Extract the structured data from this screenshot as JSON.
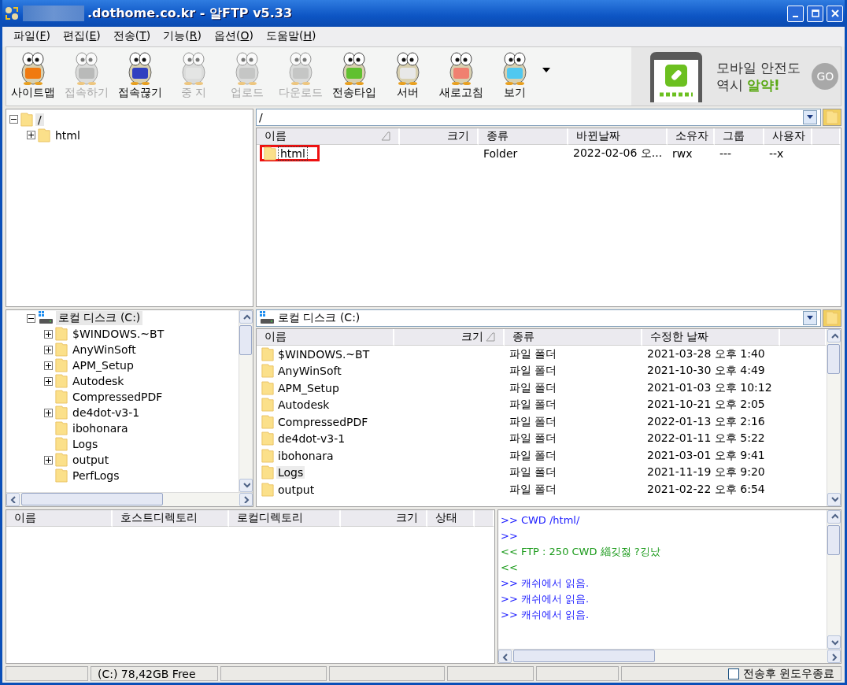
{
  "window": {
    "title": ".dothome.co.kr - 알FTP v5.33"
  },
  "menu": [
    "파일(F)",
    "편집(E)",
    "전송(T)",
    "기능(R)",
    "옵션(O)",
    "도움말(H)"
  ],
  "toolbar": [
    {
      "label": "사이트맵",
      "disabled": false
    },
    {
      "label": "접속하기",
      "disabled": true
    },
    {
      "label": "접속끊기",
      "disabled": false
    },
    {
      "label": "중 지",
      "disabled": true
    },
    {
      "label": "업로드",
      "disabled": true
    },
    {
      "label": "다운로드",
      "disabled": true
    },
    {
      "label": "전송타입",
      "disabled": false
    },
    {
      "label": "서버",
      "disabled": false
    },
    {
      "label": "새로고침",
      "disabled": false
    },
    {
      "label": "보기",
      "disabled": false
    }
  ],
  "ad": {
    "line_1": "모바일 안전도",
    "line_2": "역시",
    "highlight": "알약!",
    "button": "GO"
  },
  "remote": {
    "tree": [
      {
        "name": "/",
        "kind": "folder",
        "expandable": true,
        "expanded": true,
        "selected": true,
        "children": [
          {
            "name": "html",
            "kind": "folder",
            "expandable": true,
            "expanded": false,
            "selected": false
          }
        ]
      }
    ],
    "path": "/",
    "columns": [
      "이름",
      "크기",
      "종류",
      "바뀐날짜",
      "소유자",
      "그룹",
      "사용자"
    ],
    "rows": [
      {
        "name": "html",
        "size": "",
        "type": "Folder",
        "date": "2022-02-06 오...",
        "owner": "rwx",
        "group": "---",
        "user": "--x",
        "highlighted": true
      }
    ]
  },
  "local": {
    "tree": [
      {
        "name": "로컬 디스크 (C:)",
        "kind": "drive",
        "expandable": true,
        "expanded": true,
        "selected": true,
        "children": [
          {
            "name": "$WINDOWS.~BT",
            "kind": "folder",
            "expandable": true,
            "expanded": false,
            "selected": false
          },
          {
            "name": "AnyWinSoft",
            "kind": "folder",
            "expandable": true,
            "expanded": false,
            "selected": false
          },
          {
            "name": "APM_Setup",
            "kind": "folder",
            "expandable": true,
            "expanded": false,
            "selected": false
          },
          {
            "name": "Autodesk",
            "kind": "folder",
            "expandable": true,
            "expanded": false,
            "selected": false
          },
          {
            "name": "CompressedPDF",
            "kind": "folder",
            "expandable": false,
            "selected": false
          },
          {
            "name": "de4dot-v3-1",
            "kind": "folder",
            "expandable": true,
            "expanded": false,
            "selected": false
          },
          {
            "name": "ibohonara",
            "kind": "folder",
            "expandable": false,
            "selected": false
          },
          {
            "name": "Logs",
            "kind": "folder",
            "expandable": false,
            "selected": false
          },
          {
            "name": "output",
            "kind": "folder",
            "expandable": true,
            "expanded": false,
            "selected": false
          },
          {
            "name": "PerfLogs",
            "kind": "folder",
            "expandable": false,
            "selected": false
          }
        ]
      }
    ],
    "path": "로컬 디스크 (C:)",
    "columns": [
      "이름",
      "크기",
      "종류",
      "수정한 날짜"
    ],
    "rows": [
      {
        "name": "$WINDOWS.~BT",
        "size": "",
        "type": "파일 폴더",
        "date": "2021-03-28 오후 1:40",
        "selected": false
      },
      {
        "name": "AnyWinSoft",
        "size": "",
        "type": "파일 폴더",
        "date": "2021-10-30 오후 4:49",
        "selected": false
      },
      {
        "name": "APM_Setup",
        "size": "",
        "type": "파일 폴더",
        "date": "2021-01-03 오후 10:12",
        "selected": false
      },
      {
        "name": "Autodesk",
        "size": "",
        "type": "파일 폴더",
        "date": "2021-10-21 오후 2:05",
        "selected": false
      },
      {
        "name": "CompressedPDF",
        "size": "",
        "type": "파일 폴더",
        "date": "2022-01-13 오후 2:16",
        "selected": false
      },
      {
        "name": "de4dot-v3-1",
        "size": "",
        "type": "파일 폴더",
        "date": "2022-01-11 오후 5:22",
        "selected": false
      },
      {
        "name": "ibohonara",
        "size": "",
        "type": "파일 폴더",
        "date": "2021-03-01 오후 9:41",
        "selected": false
      },
      {
        "name": "Logs",
        "size": "",
        "type": "파일 폴더",
        "date": "2021-11-19 오후 9:20",
        "selected": true
      },
      {
        "name": "output",
        "size": "",
        "type": "파일 폴더",
        "date": "2021-02-22 오후 6:54",
        "selected": false
      }
    ]
  },
  "queue": {
    "columns": [
      "이름",
      "호스트디렉토리",
      "로컬디렉토리",
      "크기",
      "상태"
    ]
  },
  "log": [
    {
      "text": ">> CWD /html/",
      "kind": "sent"
    },
    {
      "text": ">>",
      "kind": "sent"
    },
    {
      "text": "<< FTP : 250 CWD 緇깆젏 ?깅났",
      "kind": "received"
    },
    {
      "text": "<<",
      "kind": "received"
    },
    {
      "text": ">> 캐쉬에서 읽음.",
      "kind": "sent"
    },
    {
      "text": ">> 캐쉬에서 읽음.",
      "kind": "sent"
    },
    {
      "text": ">> 캐쉬에서 읽음.",
      "kind": "sent"
    }
  ],
  "status_bar": {
    "free_space": "(C:)  78,42GB Free",
    "close_after_transfer": {
      "label": "전송후 윈도우종료",
      "checked": false
    }
  }
}
